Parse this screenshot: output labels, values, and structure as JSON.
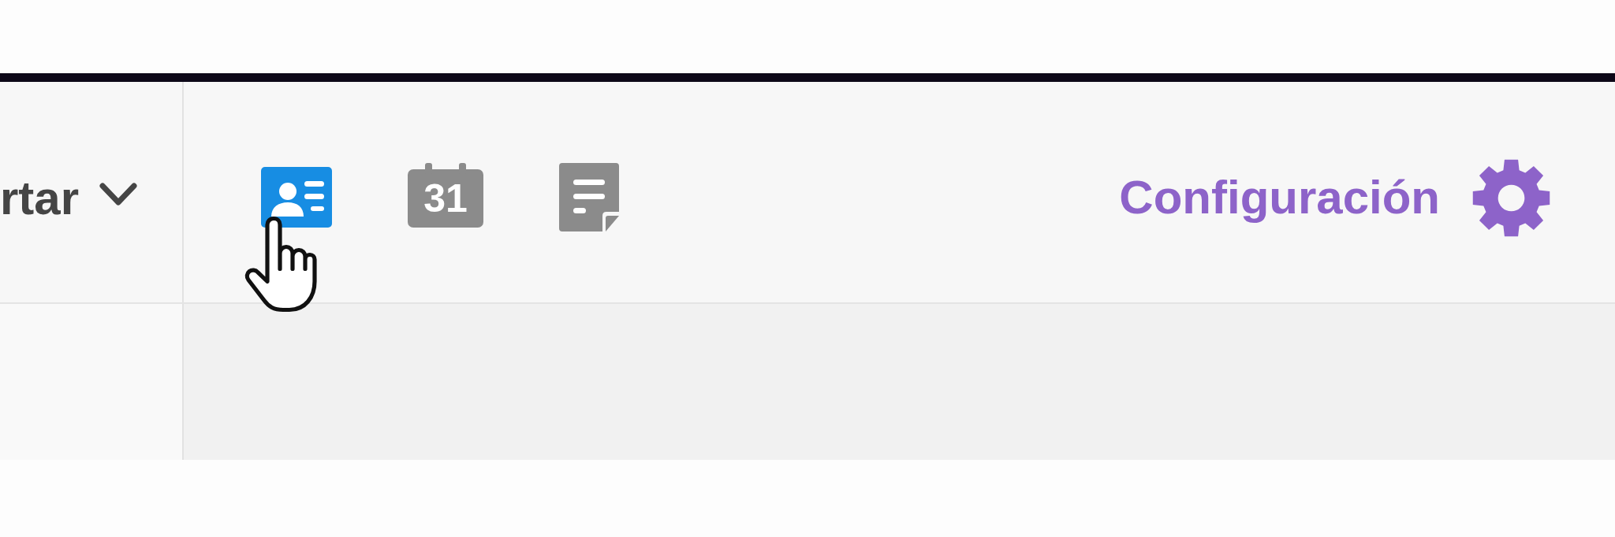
{
  "toolbar": {
    "sort_menu": {
      "label": "rtar"
    },
    "view_buttons": [
      {
        "kind": "contacts",
        "selected": true
      },
      {
        "kind": "calendar",
        "label": "31",
        "selected": false
      },
      {
        "kind": "notes",
        "selected": false
      }
    ],
    "settings_link": {
      "label": "Configuración"
    }
  }
}
